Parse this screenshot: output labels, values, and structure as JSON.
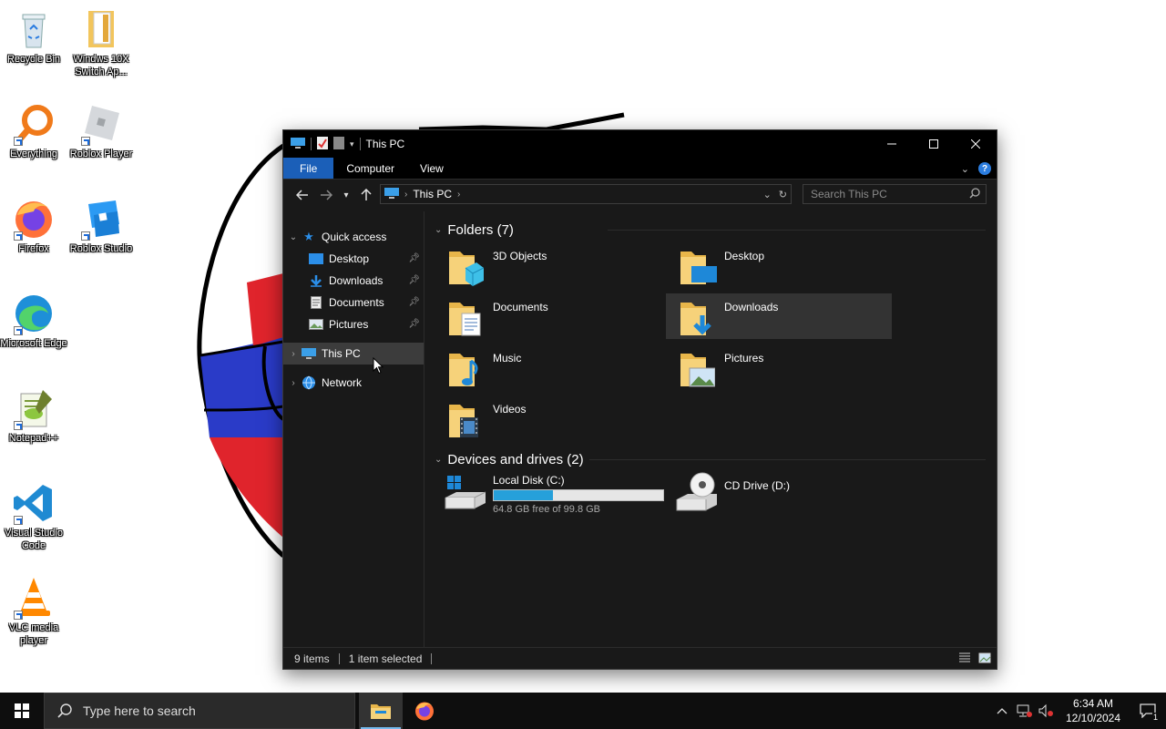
{
  "desktop": {
    "icons": [
      {
        "label": "Recycle Bin",
        "icon": "recycle-bin-icon"
      },
      {
        "label": "Windws 10X Switch Ap...",
        "icon": "folder-icon"
      },
      {
        "label": "Everything",
        "icon": "everything-search-icon"
      },
      {
        "label": "Roblox Player",
        "icon": "roblox-player-icon"
      },
      {
        "label": "Firefox",
        "icon": "firefox-icon"
      },
      {
        "label": "Roblox Studio",
        "icon": "roblox-studio-icon"
      },
      {
        "label": "Microsoft Edge",
        "icon": "edge-icon"
      },
      {
        "label": "Notepad++",
        "icon": "notepad-plus-plus-icon"
      },
      {
        "label": "Visual Studio Code",
        "icon": "vscode-icon"
      },
      {
        "label": "VLC media player",
        "icon": "vlc-icon"
      }
    ]
  },
  "window": {
    "title": "This PC",
    "ribbon_tabs": [
      "File",
      "Computer",
      "View"
    ],
    "address": {
      "crumb": "This PC"
    },
    "search": {
      "placeholder": "Search This PC"
    },
    "nav": {
      "quick_access": "Quick access",
      "quick_items": [
        "Desktop",
        "Downloads",
        "Documents",
        "Pictures"
      ],
      "this_pc": "This PC",
      "network": "Network"
    },
    "folders_header": "Folders (7)",
    "folders": [
      "3D Objects",
      "Desktop",
      "Documents",
      "Downloads",
      "Music",
      "Pictures",
      "Videos"
    ],
    "drives_header": "Devices and drives (2)",
    "drives": [
      {
        "name": "Local Disk (C:)",
        "free_text": "64.8 GB free of 99.8 GB",
        "used_fraction": 0.351
      },
      {
        "name": "CD Drive (D:)"
      }
    ],
    "status": {
      "items": "9 items",
      "selected": "1 item selected"
    }
  },
  "taskbar": {
    "search_placeholder": "Type here to search",
    "time": "6:34 AM",
    "date": "12/10/2024",
    "notification_count": "1"
  },
  "colors": {
    "accent": "#1b5fb8",
    "folder": "#f2c55c",
    "drive_bar": "#26a0da"
  }
}
